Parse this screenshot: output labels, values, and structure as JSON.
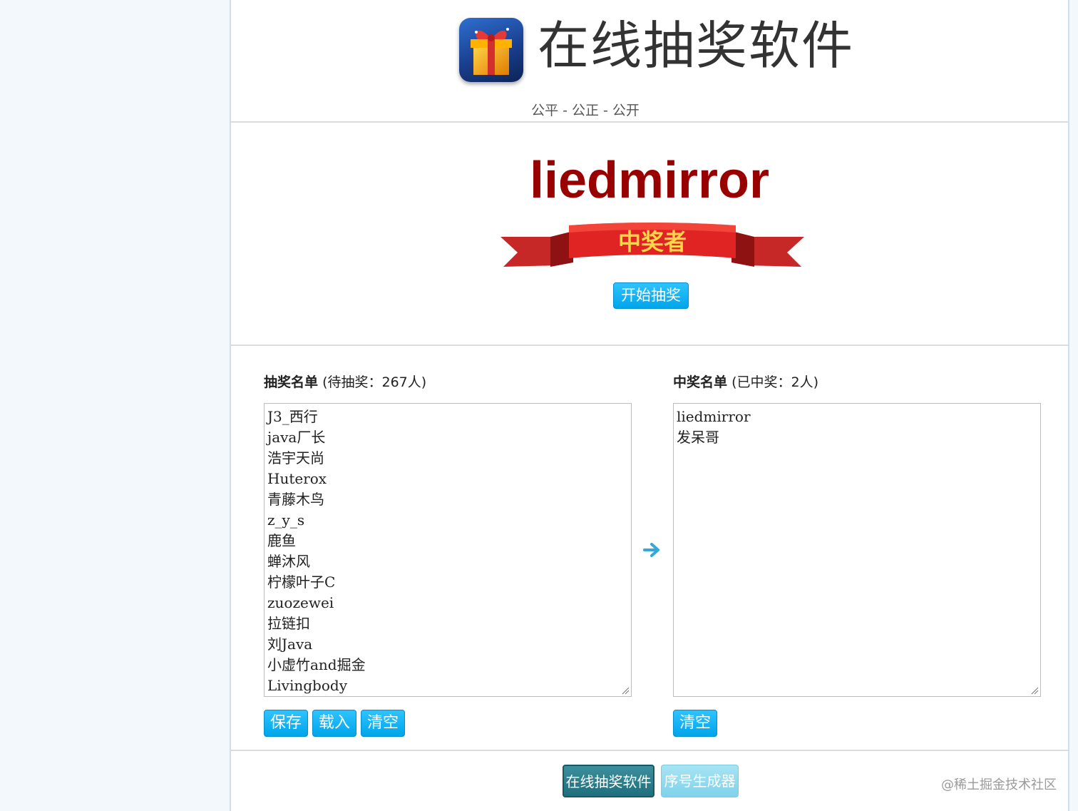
{
  "header": {
    "title": "在线抽奖软件",
    "slogan": "公平 - 公正 - 公开",
    "logo_icon": "gift-box-icon"
  },
  "winner": {
    "name": "liedmirror",
    "banner_text": "中奖者",
    "start_button": "开始抽奖"
  },
  "draw_list": {
    "title": "抽奖名单",
    "count_text": "(待抽奖：267人)",
    "entries": [
      "J3_西行",
      "java厂长",
      "浩宇天尚",
      "Huterox",
      "青藤木鸟",
      "z_y_s",
      "鹿鱼",
      "蝉沐风",
      "柠檬叶子C",
      "zuozewei",
      "拉链扣",
      "刘Java",
      "小虚竹and掘金",
      "Livingbody"
    ],
    "buttons": {
      "save": "保存",
      "load": "载入",
      "clear": "清空"
    }
  },
  "winner_list": {
    "title": "中奖名单",
    "count_text": "(已中奖：2人)",
    "entries": [
      "liedmirror",
      "发呆哥"
    ],
    "buttons": {
      "clear": "清空"
    }
  },
  "footer": {
    "primary": "在线抽奖软件",
    "secondary": "序号生成器"
  },
  "watermark": "@稀土掘金技术社区",
  "colors": {
    "accent": "#00a5ea",
    "winner_name": "#990000",
    "footer_primary": "#1f6f7d",
    "footer_secondary": "#7fd2ea"
  }
}
